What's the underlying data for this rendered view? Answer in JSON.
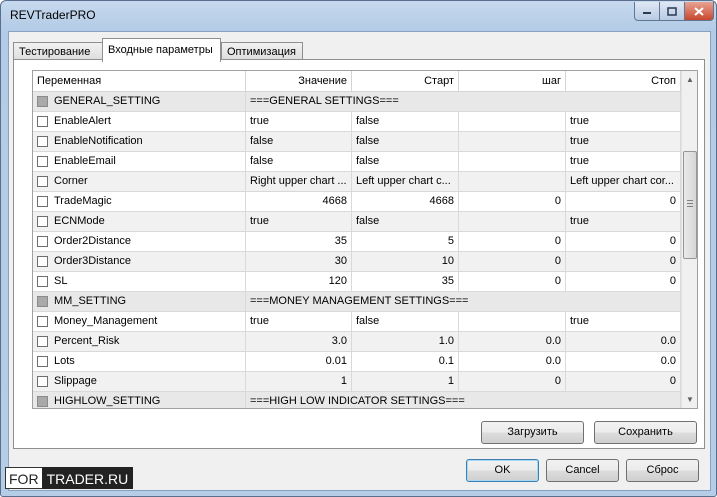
{
  "window": {
    "title": "REVTraderPRO"
  },
  "tabs": [
    {
      "label": "Тестирование"
    },
    {
      "label": "Входные параметры"
    },
    {
      "label": "Оптимизация"
    }
  ],
  "grid": {
    "columns": [
      "Переменная",
      "Значение",
      "Старт",
      "шаг",
      "Стоп"
    ],
    "rows": [
      {
        "type": "group",
        "name": "GENERAL_SETTING",
        "title": "===GENERAL SETTINGS==="
      },
      {
        "type": "param",
        "name": "EnableAlert",
        "value": "true",
        "start": "false",
        "step": "",
        "stop": "true",
        "numeric": false
      },
      {
        "type": "param",
        "name": "EnableNotification",
        "value": "false",
        "start": "false",
        "step": "",
        "stop": "true",
        "numeric": false
      },
      {
        "type": "param",
        "name": "EnableEmail",
        "value": "false",
        "start": "false",
        "step": "",
        "stop": "true",
        "numeric": false
      },
      {
        "type": "param",
        "name": "Corner",
        "value": "Right upper chart ...",
        "start": "Left upper chart c...",
        "step": "",
        "stop": "Left upper chart cor...",
        "numeric": false
      },
      {
        "type": "param",
        "name": "TradeMagic",
        "value": "4668",
        "start": "4668",
        "step": "0",
        "stop": "0",
        "numeric": true
      },
      {
        "type": "param",
        "name": "ECNMode",
        "value": "true",
        "start": "false",
        "step": "",
        "stop": "true",
        "numeric": false
      },
      {
        "type": "param",
        "name": "Order2Distance",
        "value": "35",
        "start": "5",
        "step": "0",
        "stop": "0",
        "numeric": true
      },
      {
        "type": "param",
        "name": "Order3Distance",
        "value": "30",
        "start": "10",
        "step": "0",
        "stop": "0",
        "numeric": true
      },
      {
        "type": "param",
        "name": "SL",
        "value": "120",
        "start": "35",
        "step": "0",
        "stop": "0",
        "numeric": true
      },
      {
        "type": "group",
        "name": "MM_SETTING",
        "title": "===MONEY MANAGEMENT SETTINGS==="
      },
      {
        "type": "param",
        "name": "Money_Management",
        "value": "true",
        "start": "false",
        "step": "",
        "stop": "true",
        "numeric": false
      },
      {
        "type": "param",
        "name": "Percent_Risk",
        "value": "3.0",
        "start": "1.0",
        "step": "0.0",
        "stop": "0.0",
        "numeric": true
      },
      {
        "type": "param",
        "name": "Lots",
        "value": "0.01",
        "start": "0.1",
        "step": "0.0",
        "stop": "0.0",
        "numeric": true
      },
      {
        "type": "param",
        "name": "Slippage",
        "value": "1",
        "start": "1",
        "step": "0",
        "stop": "0",
        "numeric": true
      },
      {
        "type": "group",
        "name": "HIGHLOW_SETTING",
        "title": "===HIGH LOW INDICATOR  SETTINGS==="
      }
    ]
  },
  "buttons": {
    "load": "Загрузить",
    "save": "Сохранить",
    "ok": "OK",
    "cancel": "Cancel",
    "reset": "Сброс"
  },
  "watermark": {
    "part1": "FOR",
    "part2": "TRADER.RU"
  }
}
